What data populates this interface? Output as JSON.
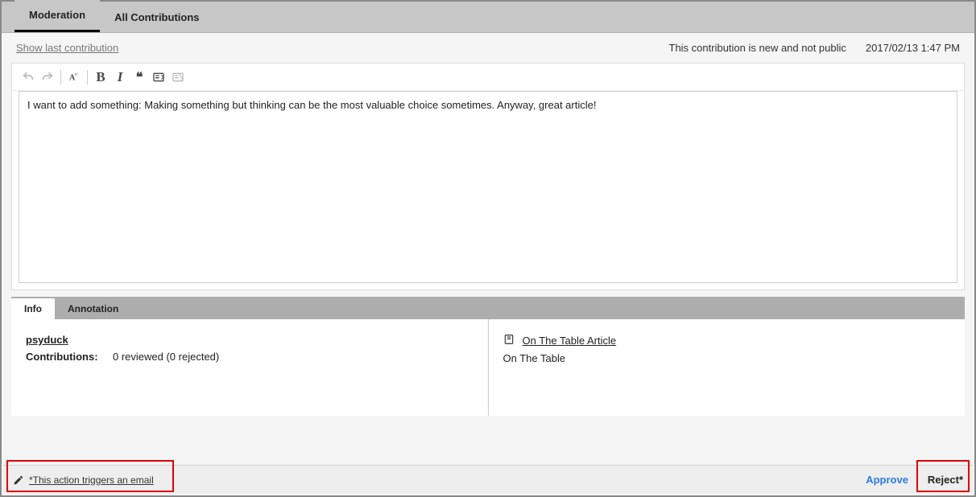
{
  "tabs": {
    "moderation": "Moderation",
    "all_contributions": "All Contributions"
  },
  "status_bar": {
    "show_last": "Show last contribution",
    "status": "This contribution is new and not public",
    "timestamp": "2017/02/13 1:47 PM"
  },
  "editor": {
    "content": "I want to add something: Making something but thinking can be the most valuable choice sometimes. Anyway, great article!"
  },
  "sub_tabs": {
    "info": "Info",
    "annotation": "Annotation"
  },
  "info": {
    "user": "psyduck",
    "contrib_label": "Contributions:",
    "contrib_value": "0 reviewed (0 rejected)",
    "article_link": "On The Table Article",
    "article_title": "On The Table"
  },
  "footer": {
    "email_note": "*This action triggers an email",
    "approve": "Approve",
    "reject": "Reject*"
  }
}
